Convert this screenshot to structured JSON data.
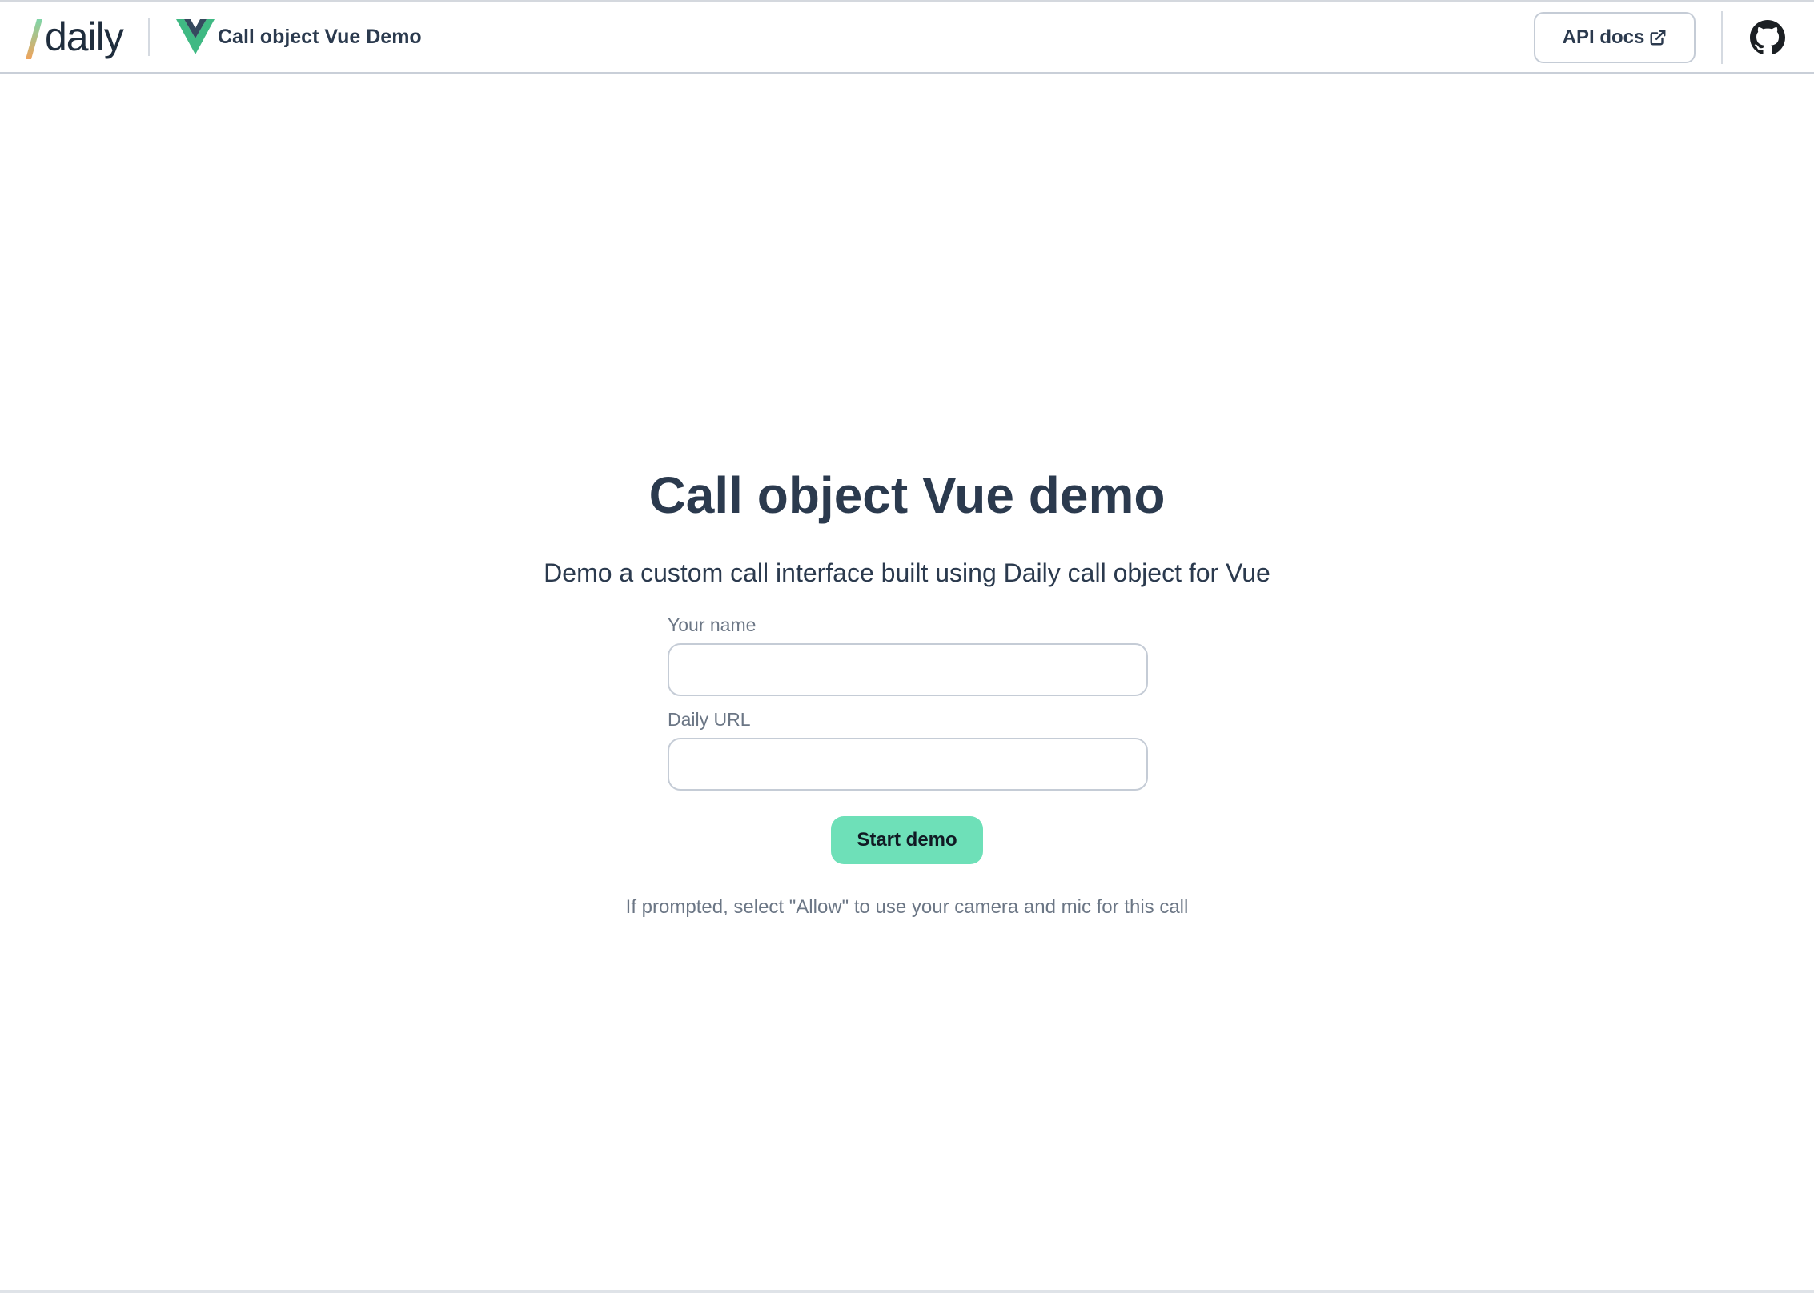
{
  "header": {
    "logo_text": "daily",
    "app_title": "Call object Vue Demo",
    "api_docs_label": "API docs"
  },
  "main": {
    "title": "Call object Vue demo",
    "subtitle": "Demo a custom call interface built using Daily call object for Vue",
    "name_field": {
      "label": "Your name",
      "value": "",
      "placeholder": ""
    },
    "url_field": {
      "label": "Daily URL",
      "value": "",
      "placeholder": ""
    },
    "start_label": "Start demo",
    "hint": "If prompted, select \"Allow\" to use your camera and mic for this call"
  },
  "icons": {
    "brand": "vue-logo-icon",
    "external_link": "external-link-icon",
    "repo": "github-icon"
  },
  "colors": {
    "accent": "#6ee0b8",
    "text": "#2b3a4e",
    "muted": "#6b7685",
    "border": "#c5ccd6"
  }
}
